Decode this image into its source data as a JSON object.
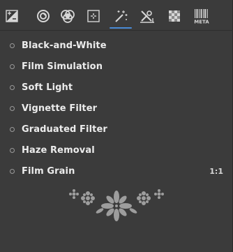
{
  "toolbar": {
    "tabs": [
      {
        "icon": "exposure-icon",
        "active": false
      },
      {
        "icon": "lens-aperture-icon",
        "active": false
      },
      {
        "icon": "color-rgb-icon",
        "active": false
      },
      {
        "icon": "crop-crosshair-icon",
        "active": false
      },
      {
        "icon": "magic-wand-icon",
        "active": true
      },
      {
        "icon": "tools-repair-icon",
        "active": false
      },
      {
        "icon": "checkerboard-icon",
        "active": false
      },
      {
        "icon": "barcode-meta-icon",
        "active": false,
        "label": "META"
      }
    ],
    "accent_color": "#4a8bd6"
  },
  "tools": [
    {
      "label": "Black-and-White",
      "shortcut": ""
    },
    {
      "label": "Film Simulation",
      "shortcut": ""
    },
    {
      "label": "Soft Light",
      "shortcut": ""
    },
    {
      "label": "Vignette Filter",
      "shortcut": ""
    },
    {
      "label": "Graduated Filter",
      "shortcut": ""
    },
    {
      "label": "Haze Removal",
      "shortcut": ""
    },
    {
      "label": "Film Grain",
      "shortcut": "1:1"
    }
  ],
  "colors": {
    "background": "#3b3b3b",
    "text": "#ececec",
    "icon": "#d6d6d6"
  }
}
